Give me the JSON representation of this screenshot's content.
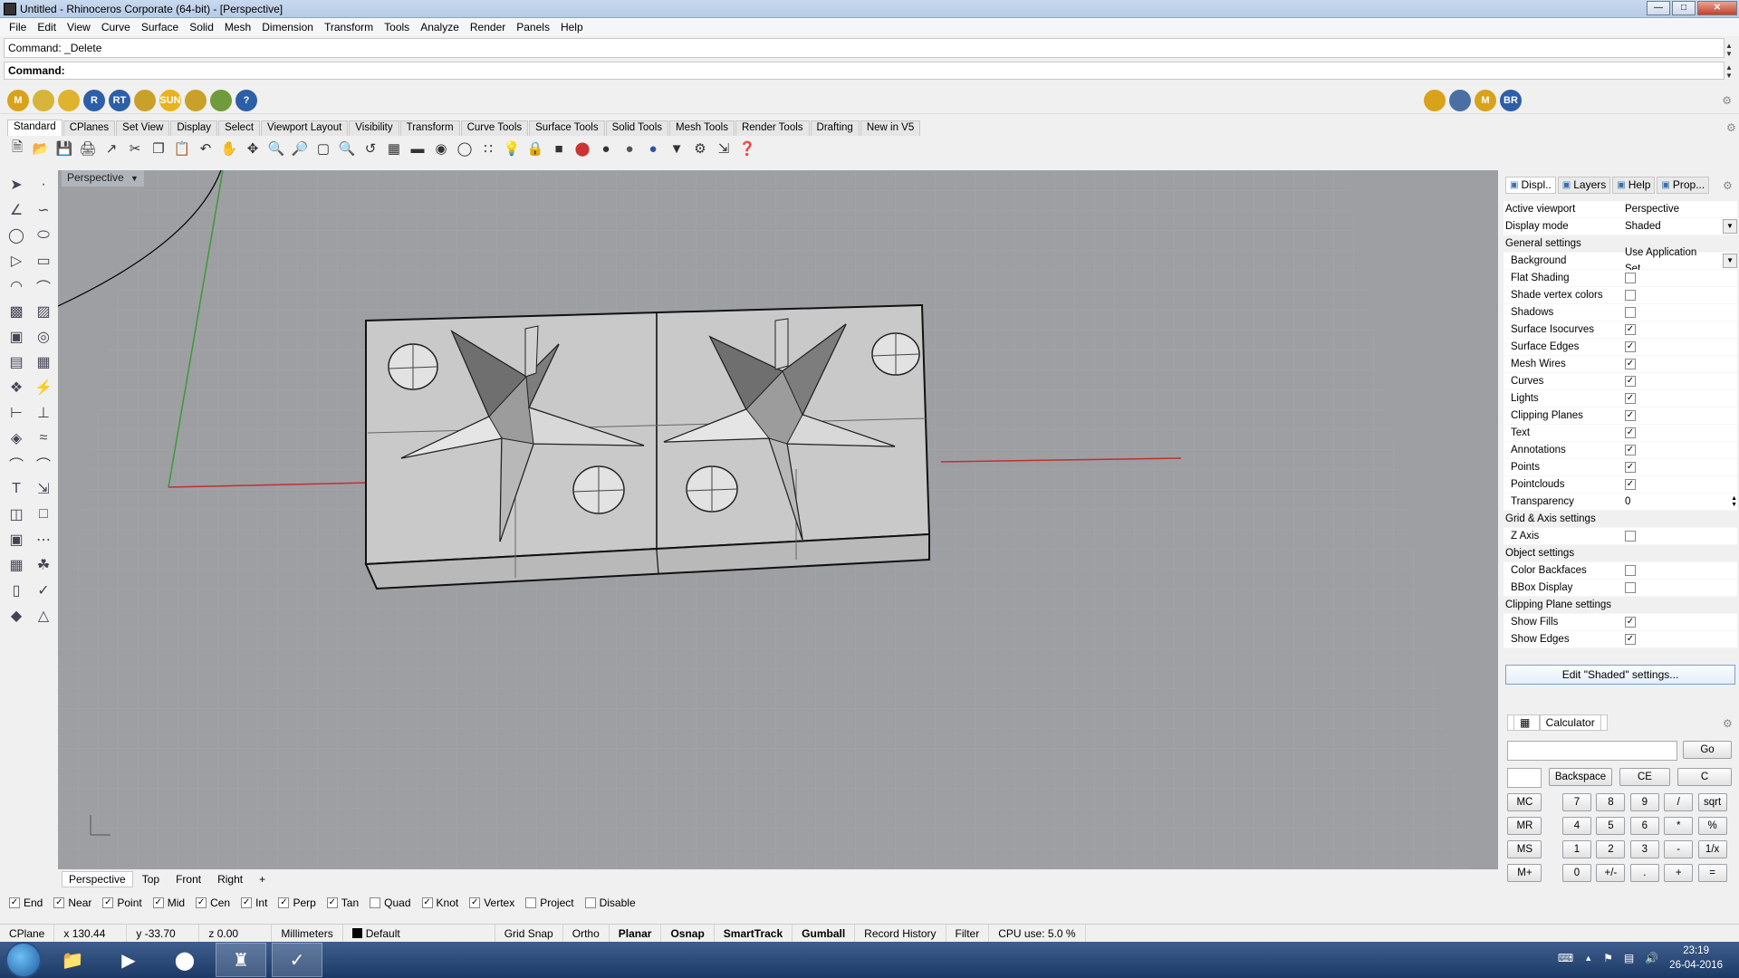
{
  "window": {
    "title": "Untitled - Rhinoceros Corporate (64-bit) - [Perspective]"
  },
  "menu": [
    "File",
    "Edit",
    "View",
    "Curve",
    "Surface",
    "Solid",
    "Mesh",
    "Dimension",
    "Transform",
    "Tools",
    "Analyze",
    "Render",
    "Panels",
    "Help"
  ],
  "command": {
    "history": "Command: _Delete",
    "prompt": "Command:"
  },
  "toolbar_tabs": [
    "Standard",
    "CPlanes",
    "Set View",
    "Display",
    "Select",
    "Viewport Layout",
    "Visibility",
    "Transform",
    "Curve Tools",
    "Surface Tools",
    "Solid Tools",
    "Mesh Tools",
    "Render Tools",
    "Drafting",
    "New in V5"
  ],
  "active_toolbar_tab": "Standard",
  "plugin_icons": [
    {
      "label": "M",
      "color": "#d9a21b"
    },
    {
      "label": "",
      "color": "#d7b43a"
    },
    {
      "label": "",
      "color": "#e0b32c"
    },
    {
      "label": "R",
      "color": "#2d5ea8"
    },
    {
      "label": "RT",
      "color": "#2d5ea8"
    },
    {
      "label": "",
      "color": "#c9a12a"
    },
    {
      "label": "SUN",
      "color": "#e8b31f"
    },
    {
      "label": "",
      "color": "#c9a12a"
    },
    {
      "label": "",
      "color": "#6f9b3a"
    },
    {
      "label": "?",
      "color": "#2d5ea8"
    }
  ],
  "right_icons": [
    {
      "label": "",
      "color": "#d9a21b"
    },
    {
      "label": "",
      "color": "#4b6fa3"
    },
    {
      "label": "M",
      "color": "#d9a21b"
    },
    {
      "label": "BR",
      "color": "#2d5ea8"
    }
  ],
  "viewport": {
    "title": "Perspective"
  },
  "view_tabs": [
    "Perspective",
    "Top",
    "Front",
    "Right"
  ],
  "active_view_tab": "Perspective",
  "osnaps": [
    {
      "label": "End",
      "checked": true
    },
    {
      "label": "Near",
      "checked": true
    },
    {
      "label": "Point",
      "checked": true
    },
    {
      "label": "Mid",
      "checked": true
    },
    {
      "label": "Cen",
      "checked": true
    },
    {
      "label": "Int",
      "checked": true
    },
    {
      "label": "Perp",
      "checked": true
    },
    {
      "label": "Tan",
      "checked": true
    },
    {
      "label": "Quad",
      "checked": false
    },
    {
      "label": "Knot",
      "checked": true
    },
    {
      "label": "Vertex",
      "checked": true
    },
    {
      "label": "Project",
      "checked": false
    },
    {
      "label": "Disable",
      "checked": false
    }
  ],
  "status": {
    "cplane": "CPlane",
    "x": "x 130.44",
    "y": "y -33.70",
    "z": "z 0.00",
    "units": "Millimeters",
    "layer": "Default",
    "toggles": [
      {
        "label": "Grid Snap",
        "bold": false
      },
      {
        "label": "Ortho",
        "bold": false
      },
      {
        "label": "Planar",
        "bold": true
      },
      {
        "label": "Osnap",
        "bold": true
      },
      {
        "label": "SmartTrack",
        "bold": true
      },
      {
        "label": "Gumball",
        "bold": true
      },
      {
        "label": "Record History",
        "bold": false
      },
      {
        "label": "Filter",
        "bold": false
      }
    ],
    "cpu": "CPU use: 5.0 %"
  },
  "panel": {
    "tabs": [
      {
        "label": "Displ..",
        "icon": "display-icon"
      },
      {
        "label": "Layers",
        "icon": "layers-icon"
      },
      {
        "label": "Help",
        "icon": "help-icon"
      },
      {
        "label": "Prop...",
        "icon": "properties-icon"
      }
    ],
    "active_viewport": {
      "label": "Active viewport",
      "value": "Perspective"
    },
    "display_mode": {
      "label": "Display mode",
      "value": "Shaded"
    },
    "general_header": "General settings",
    "background": {
      "label": "Background",
      "value": "Use Application Set..."
    },
    "general": [
      {
        "label": "Flat Shading",
        "checked": false
      },
      {
        "label": "Shade vertex colors",
        "checked": false
      },
      {
        "label": "Shadows",
        "checked": false
      },
      {
        "label": "Surface Isocurves",
        "checked": true
      },
      {
        "label": "Surface Edges",
        "checked": true
      },
      {
        "label": "Mesh Wires",
        "checked": true
      },
      {
        "label": "Curves",
        "checked": true
      },
      {
        "label": "Lights",
        "checked": true
      },
      {
        "label": "Clipping Planes",
        "checked": true
      },
      {
        "label": "Text",
        "checked": true
      },
      {
        "label": "Annotations",
        "checked": true
      },
      {
        "label": "Points",
        "checked": true
      },
      {
        "label": "Pointclouds",
        "checked": true
      }
    ],
    "transparency": {
      "label": "Transparency",
      "value": "0"
    },
    "grid_header": "Grid & Axis settings",
    "grid": [
      {
        "label": "Z Axis",
        "checked": false
      }
    ],
    "object_header": "Object settings",
    "object": [
      {
        "label": "Color Backfaces",
        "checked": false
      },
      {
        "label": "BBox Display",
        "checked": false
      }
    ],
    "clip_header": "Clipping Plane settings",
    "clip": [
      {
        "label": "Show Fills",
        "checked": true
      },
      {
        "label": "Show Edges",
        "checked": true
      }
    ],
    "edit_button": "Edit \"Shaded\" settings..."
  },
  "calculator": {
    "title": "Calculator",
    "go": "Go",
    "backspace": "Backspace",
    "ce": "CE",
    "c": "C",
    "rows": [
      [
        "MC",
        "7",
        "8",
        "9",
        "/",
        "sqrt"
      ],
      [
        "MR",
        "4",
        "5",
        "6",
        "*",
        "%"
      ],
      [
        "MS",
        "1",
        "2",
        "3",
        "-",
        "1/x"
      ],
      [
        "M+",
        "0",
        "+/-",
        ".",
        "+",
        "="
      ]
    ]
  },
  "taskbar": {
    "time": "23:19",
    "date": "26-04-2016"
  }
}
